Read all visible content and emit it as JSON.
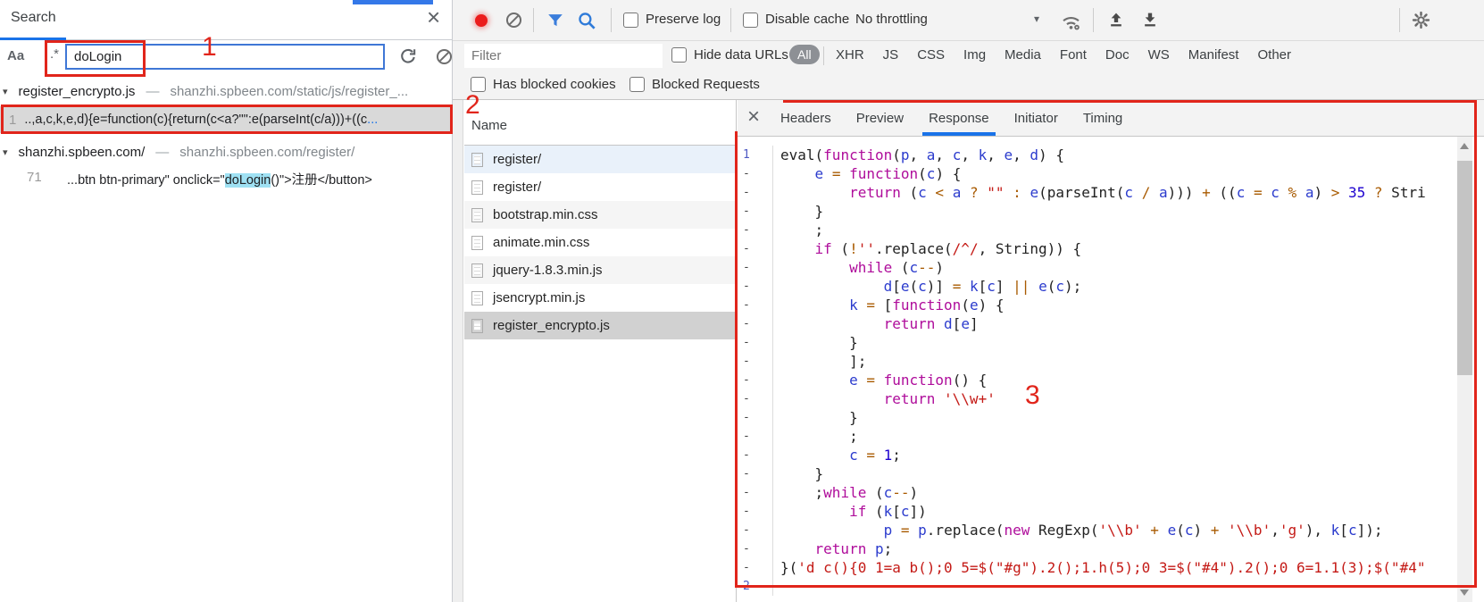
{
  "annotation": {
    "color": "#e1251b",
    "digit_one": "1",
    "digit_two": "2",
    "digit_three": "3"
  },
  "search_panel": {
    "title": "Search",
    "close_icon": "×",
    "match_case_label": "Aa",
    "regex_label": ".*",
    "query": "doLogin",
    "expander": "▾",
    "separator": "—",
    "results": [
      {
        "file": "register_encrypto.js",
        "url": "shanzhi.spbeen.com/static/js/register_...",
        "line_number": "1",
        "match_pre": "..,a,c,k,e,d){e=function(c){return(c<a?\"\":e(parseInt(c/a)))+((c",
        "match_ellipsis": "..."
      },
      {
        "file": "shanzhi.spbeen.com/",
        "url": "shanzhi.spbeen.com/register/",
        "line_number": "71",
        "match_pre": "...btn btn-primary\" onclick=\"",
        "match_highlight": "doLogin",
        "match_post": "()\">注册</button>"
      }
    ]
  },
  "network_toolbar": {
    "preserve_log": "Preserve log",
    "disable_cache": "Disable cache",
    "throttling_value": "No throttling",
    "caret": "▾"
  },
  "filter_bar": {
    "filter_placeholder": "Filter",
    "hide_data_urls": "Hide data URLs",
    "active_type": "All",
    "types": [
      "All",
      "XHR",
      "JS",
      "CSS",
      "Img",
      "Media",
      "Font",
      "Doc",
      "WS",
      "Manifest",
      "Other"
    ]
  },
  "blocked_bar": {
    "has_blocked_cookies": "Has blocked cookies",
    "blocked_requests": "Blocked Requests"
  },
  "requests": {
    "column_header": "Name",
    "rows": [
      "register/",
      "register/",
      "bootstrap.min.css",
      "animate.min.css",
      "jquery-1.8.3.min.js",
      "jsencrypt.min.js",
      "register_encrypto.js"
    ],
    "selected_index": 6
  },
  "detail_panel": {
    "close_icon": "×",
    "tabs": [
      "Headers",
      "Preview",
      "Response",
      "Initiator",
      "Timing"
    ],
    "active_tab": "Response",
    "response_code": {
      "tail_line_number": "2",
      "lines": [
        {
          "g": "1",
          "t": [
            [
              "p",
              "eval("
            ],
            [
              "k",
              "function"
            ],
            [
              "p",
              "("
            ],
            [
              "v",
              "p"
            ],
            [
              "p",
              ", "
            ],
            [
              "v",
              "a"
            ],
            [
              "p",
              ", "
            ],
            [
              "v",
              "c"
            ],
            [
              "p",
              ", "
            ],
            [
              "v",
              "k"
            ],
            [
              "p",
              ", "
            ],
            [
              "v",
              "e"
            ],
            [
              "p",
              ", "
            ],
            [
              "v",
              "d"
            ],
            [
              "p",
              ") {"
            ]
          ]
        },
        {
          "g": "-",
          "t": [
            [
              "p",
              "    "
            ],
            [
              "v",
              "e"
            ],
            [
              "p",
              " "
            ],
            [
              "o",
              "="
            ],
            [
              "p",
              " "
            ],
            [
              "k",
              "function"
            ],
            [
              "p",
              "("
            ],
            [
              "v",
              "c"
            ],
            [
              "p",
              ") {"
            ]
          ]
        },
        {
          "g": "-",
          "t": [
            [
              "p",
              "        "
            ],
            [
              "k",
              "return"
            ],
            [
              "p",
              " ("
            ],
            [
              "v",
              "c"
            ],
            [
              "p",
              " "
            ],
            [
              "o",
              "<"
            ],
            [
              "p",
              " "
            ],
            [
              "v",
              "a"
            ],
            [
              "p",
              " "
            ],
            [
              "o",
              "?"
            ],
            [
              "p",
              " "
            ],
            [
              "s",
              "\"\""
            ],
            [
              "p",
              " "
            ],
            [
              "o",
              ":"
            ],
            [
              "p",
              " "
            ],
            [
              "v",
              "e"
            ],
            [
              "p",
              "(parseInt("
            ],
            [
              "v",
              "c"
            ],
            [
              "p",
              " "
            ],
            [
              "o",
              "/"
            ],
            [
              "p",
              " "
            ],
            [
              "v",
              "a"
            ],
            [
              "p",
              "))) "
            ],
            [
              "o",
              "+"
            ],
            [
              "p",
              " (("
            ],
            [
              "v",
              "c"
            ],
            [
              "p",
              " "
            ],
            [
              "o",
              "="
            ],
            [
              "p",
              " "
            ],
            [
              "v",
              "c"
            ],
            [
              "p",
              " "
            ],
            [
              "o",
              "%"
            ],
            [
              "p",
              " "
            ],
            [
              "v",
              "a"
            ],
            [
              "p",
              ") "
            ],
            [
              "o",
              ">"
            ],
            [
              "p",
              " "
            ],
            [
              "n",
              "35"
            ],
            [
              "p",
              " "
            ],
            [
              "o",
              "?"
            ],
            [
              "p",
              " Stri"
            ]
          ]
        },
        {
          "g": "-",
          "t": [
            [
              "p",
              "    }"
            ]
          ]
        },
        {
          "g": "-",
          "t": [
            [
              "p",
              "    ;"
            ]
          ]
        },
        {
          "g": "-",
          "t": [
            [
              "p",
              "    "
            ],
            [
              "k",
              "if"
            ],
            [
              "p",
              " ("
            ],
            [
              "o",
              "!"
            ],
            [
              "s",
              "''"
            ],
            [
              "p",
              ".replace("
            ],
            [
              "s",
              "/^/"
            ],
            [
              "p",
              ", String)) {"
            ]
          ]
        },
        {
          "g": "-",
          "t": [
            [
              "p",
              "        "
            ],
            [
              "k",
              "while"
            ],
            [
              "p",
              " ("
            ],
            [
              "v",
              "c"
            ],
            [
              "o",
              "--"
            ],
            [
              "p",
              ")"
            ]
          ]
        },
        {
          "g": "-",
          "t": [
            [
              "p",
              "            "
            ],
            [
              "v",
              "d"
            ],
            [
              "p",
              "["
            ],
            [
              "v",
              "e"
            ],
            [
              "p",
              "("
            ],
            [
              "v",
              "c"
            ],
            [
              "p",
              ")] "
            ],
            [
              "o",
              "="
            ],
            [
              "p",
              " "
            ],
            [
              "v",
              "k"
            ],
            [
              "p",
              "["
            ],
            [
              "v",
              "c"
            ],
            [
              "p",
              "] "
            ],
            [
              "o",
              "||"
            ],
            [
              "p",
              " "
            ],
            [
              "v",
              "e"
            ],
            [
              "p",
              "("
            ],
            [
              "v",
              "c"
            ],
            [
              "p",
              ");"
            ]
          ]
        },
        {
          "g": "-",
          "t": [
            [
              "p",
              "        "
            ],
            [
              "v",
              "k"
            ],
            [
              "p",
              " "
            ],
            [
              "o",
              "="
            ],
            [
              "p",
              " ["
            ],
            [
              "k",
              "function"
            ],
            [
              "p",
              "("
            ],
            [
              "v",
              "e"
            ],
            [
              "p",
              ") {"
            ]
          ]
        },
        {
          "g": "-",
          "t": [
            [
              "p",
              "            "
            ],
            [
              "k",
              "return"
            ],
            [
              "p",
              " "
            ],
            [
              "v",
              "d"
            ],
            [
              "p",
              "["
            ],
            [
              "v",
              "e"
            ],
            [
              "p",
              "]"
            ]
          ]
        },
        {
          "g": "-",
          "t": [
            [
              "p",
              "        }"
            ]
          ]
        },
        {
          "g": "-",
          "t": [
            [
              "p",
              "        ];"
            ]
          ]
        },
        {
          "g": "-",
          "t": [
            [
              "p",
              "        "
            ],
            [
              "v",
              "e"
            ],
            [
              "p",
              " "
            ],
            [
              "o",
              "="
            ],
            [
              "p",
              " "
            ],
            [
              "k",
              "function"
            ],
            [
              "p",
              "() {"
            ]
          ]
        },
        {
          "g": "-",
          "t": [
            [
              "p",
              "            "
            ],
            [
              "k",
              "return"
            ],
            [
              "p",
              " "
            ],
            [
              "s",
              "'\\\\w+'"
            ]
          ]
        },
        {
          "g": "-",
          "t": [
            [
              "p",
              "        }"
            ]
          ]
        },
        {
          "g": "-",
          "t": [
            [
              "p",
              "        ;"
            ]
          ]
        },
        {
          "g": "-",
          "t": [
            [
              "p",
              "        "
            ],
            [
              "v",
              "c"
            ],
            [
              "p",
              " "
            ],
            [
              "o",
              "="
            ],
            [
              "p",
              " "
            ],
            [
              "n",
              "1"
            ],
            [
              "p",
              ";"
            ]
          ]
        },
        {
          "g": "-",
          "t": [
            [
              "p",
              "    }"
            ]
          ]
        },
        {
          "g": "-",
          "t": [
            [
              "p",
              "    ;"
            ],
            [
              "k",
              "while"
            ],
            [
              "p",
              " ("
            ],
            [
              "v",
              "c"
            ],
            [
              "o",
              "--"
            ],
            [
              "p",
              ")"
            ]
          ]
        },
        {
          "g": "-",
          "t": [
            [
              "p",
              "        "
            ],
            [
              "k",
              "if"
            ],
            [
              "p",
              " ("
            ],
            [
              "v",
              "k"
            ],
            [
              "p",
              "["
            ],
            [
              "v",
              "c"
            ],
            [
              "p",
              "])"
            ]
          ]
        },
        {
          "g": "-",
          "t": [
            [
              "p",
              "            "
            ],
            [
              "v",
              "p"
            ],
            [
              "p",
              " "
            ],
            [
              "o",
              "="
            ],
            [
              "p",
              " "
            ],
            [
              "v",
              "p"
            ],
            [
              "p",
              ".replace("
            ],
            [
              "k",
              "new"
            ],
            [
              "p",
              " RegExp("
            ],
            [
              "s",
              "'\\\\b'"
            ],
            [
              "p",
              " "
            ],
            [
              "o",
              "+"
            ],
            [
              "p",
              " "
            ],
            [
              "v",
              "e"
            ],
            [
              "p",
              "("
            ],
            [
              "v",
              "c"
            ],
            [
              "p",
              ") "
            ],
            [
              "o",
              "+"
            ],
            [
              "p",
              " "
            ],
            [
              "s",
              "'\\\\b'"
            ],
            [
              "p",
              ","
            ],
            [
              "s",
              "'g'"
            ],
            [
              "p",
              "), "
            ],
            [
              "v",
              "k"
            ],
            [
              "p",
              "["
            ],
            [
              "v",
              "c"
            ],
            [
              "p",
              "]);"
            ]
          ]
        },
        {
          "g": "-",
          "t": [
            [
              "p",
              "    "
            ],
            [
              "k",
              "return"
            ],
            [
              "p",
              " "
            ],
            [
              "v",
              "p"
            ],
            [
              "p",
              ";"
            ]
          ]
        },
        {
          "g": "-",
          "t": [
            [
              "p",
              "}("
            ],
            [
              "s",
              "'d c(){0 1=a b();0 5=$(\"#g\").2();1.h(5);0 3=$(\"#4\").2();0 6=1.1(3);$(\"#4\""
            ]
          ]
        }
      ]
    }
  }
}
